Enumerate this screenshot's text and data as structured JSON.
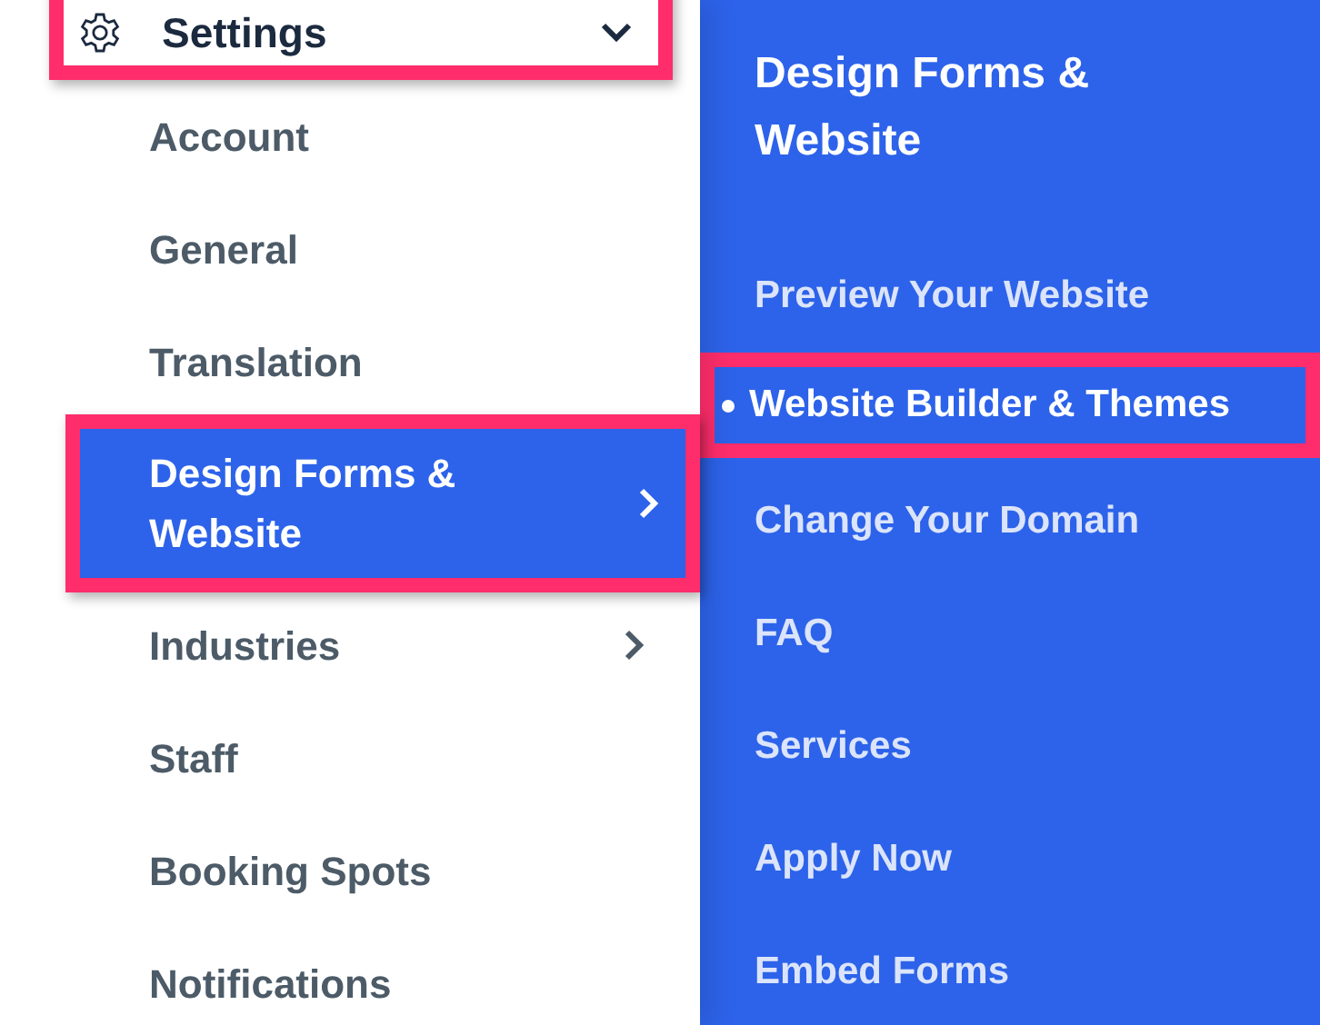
{
  "header": {
    "title": "Settings",
    "expanded": true,
    "highlighted": true
  },
  "menu": [
    {
      "label": "Account",
      "selected": false,
      "highlighted": false,
      "has_submenu": false
    },
    {
      "label": "General",
      "selected": false,
      "highlighted": false,
      "has_submenu": false
    },
    {
      "label": "Translation",
      "selected": false,
      "highlighted": false,
      "has_submenu": false
    },
    {
      "label": "Design Forms & Website",
      "selected": true,
      "highlighted": true,
      "has_submenu": true
    },
    {
      "label": "Industries",
      "selected": false,
      "highlighted": false,
      "has_submenu": true
    },
    {
      "label": "Staff",
      "selected": false,
      "highlighted": false,
      "has_submenu": false
    },
    {
      "label": "Booking Spots",
      "selected": false,
      "highlighted": false,
      "has_submenu": false
    },
    {
      "label": "Notifications",
      "selected": false,
      "highlighted": false,
      "has_submenu": false
    }
  ],
  "submenu": {
    "title": "Design Forms & Website",
    "items": [
      {
        "label": "Preview Your Website",
        "selected": false,
        "highlighted": false
      },
      {
        "label": "Website Builder & Themes",
        "selected": true,
        "highlighted": true
      },
      {
        "label": "Change Your Domain",
        "selected": false,
        "highlighted": false
      },
      {
        "label": "FAQ",
        "selected": false,
        "highlighted": false
      },
      {
        "label": "Services",
        "selected": false,
        "highlighted": false
      },
      {
        "label": "Apply Now",
        "selected": false,
        "highlighted": false
      },
      {
        "label": "Embed Forms",
        "selected": false,
        "highlighted": false
      }
    ]
  }
}
